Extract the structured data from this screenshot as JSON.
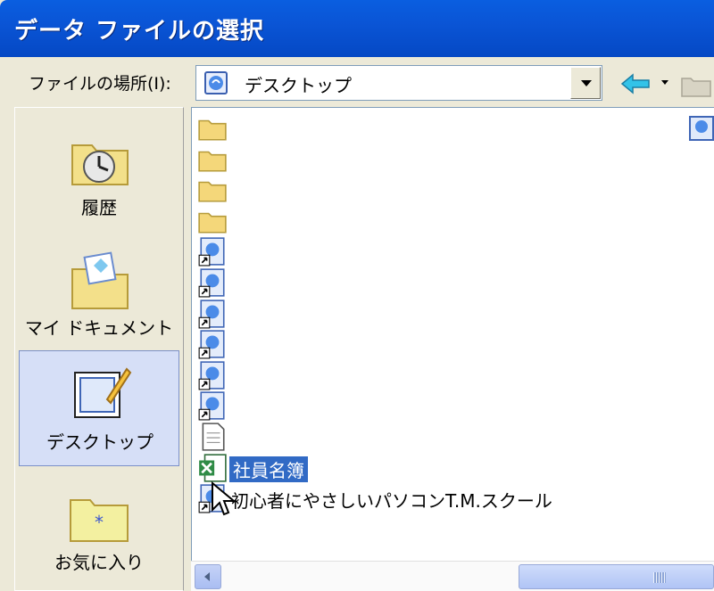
{
  "window": {
    "title": "データ ファイルの選択"
  },
  "toolbar": {
    "look_in_label": "ファイルの場所(I):",
    "look_in_value": "デスクトップ",
    "look_in_icon": "desktop-icon",
    "back_icon": "back-arrow-icon",
    "up_icon": "up-folder-icon"
  },
  "places": [
    {
      "label": "履歴",
      "icon": "history-icon"
    },
    {
      "label": "マイ ドキュメント",
      "icon": "my-documents-icon"
    },
    {
      "label": "デスクトップ",
      "icon": "desktop-icon",
      "selected": true
    },
    {
      "label": "お気に入り",
      "icon": "favorites-icon"
    }
  ],
  "files": [
    {
      "name": "",
      "icon": "folder-icon"
    },
    {
      "name": "",
      "icon": "folder-icon"
    },
    {
      "name": "",
      "icon": "folder-icon"
    },
    {
      "name": "",
      "icon": "folder-icon"
    },
    {
      "name": "",
      "icon": "shortcut-icon"
    },
    {
      "name": "",
      "icon": "shortcut-icon"
    },
    {
      "name": "",
      "icon": "shortcut-icon"
    },
    {
      "name": "",
      "icon": "shortcut-icon"
    },
    {
      "name": "",
      "icon": "shortcut-icon"
    },
    {
      "name": "",
      "icon": "shortcut-icon"
    },
    {
      "name": "",
      "icon": "document-icon"
    },
    {
      "name": "社員名簿",
      "icon": "excel-file-icon",
      "selected": true
    },
    {
      "name": "初心者にやさしいパソコンT.M.スクール",
      "icon": "shortcut-icon"
    }
  ],
  "colors": {
    "titlebar": "#0a55d6",
    "selection": "#316ac5",
    "dialog_bg": "#ece9d8"
  }
}
